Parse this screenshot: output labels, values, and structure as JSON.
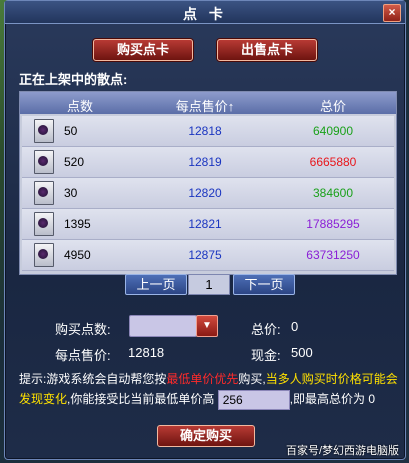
{
  "window": {
    "title": "点 卡",
    "close_label": "×"
  },
  "tabs": {
    "buy_label": "购买点卡",
    "sell_label": "出售点卡"
  },
  "section_label": "正在上架中的散点:",
  "table": {
    "headers": {
      "points": "点数",
      "price": "每点售价↑",
      "total": "总价"
    },
    "rows": [
      {
        "points": "50",
        "price": "12818",
        "total": "640900",
        "total_color": "#1aa11a"
      },
      {
        "points": "520",
        "price": "12819",
        "total": "6665880",
        "total_color": "#e8161b"
      },
      {
        "points": "30",
        "price": "12820",
        "total": "384600",
        "total_color": "#1aa11a"
      },
      {
        "points": "1395",
        "price": "12821",
        "total": "17885295",
        "total_color": "#8a1ed6"
      },
      {
        "points": "4950",
        "price": "12875",
        "total": "63731250",
        "total_color": "#8a1ed6"
      }
    ]
  },
  "pager": {
    "prev_label": "上一页",
    "page_number": "1",
    "next_label": "下一页"
  },
  "form": {
    "buy_points_label": "购买点数:",
    "total_label": "总价:",
    "total_value": "0",
    "unit_price_label": "每点售价:",
    "unit_price_value": "12818",
    "cash_label": "现金:",
    "cash_value": "500"
  },
  "hint": {
    "part1": "提示:游戏系统会自动帮您按",
    "part2": "最低单价优先",
    "part3": "购买,",
    "part4": "当多人购买时价格可能会发现变化",
    "part5": ",你能接受比当前最低单价高",
    "input_value": "256",
    "part6": ",即最高总价为 0"
  },
  "confirm_label": "确定购买",
  "watermark": "百家号/梦幻西游电脑版",
  "colors": {
    "window_bg": "#1a2742",
    "accent_red": "#b83a34",
    "accent_blue": "#4e6fb7"
  }
}
